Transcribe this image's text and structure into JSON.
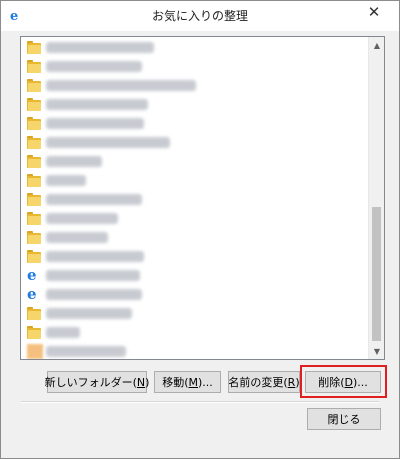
{
  "window": {
    "title": "お気に入りの整理",
    "close_glyph": "✕"
  },
  "list": {
    "items": [
      {
        "icon": "folder-icon"
      },
      {
        "icon": "folder-icon"
      },
      {
        "icon": "folder-icon"
      },
      {
        "icon": "folder-icon"
      },
      {
        "icon": "folder-icon"
      },
      {
        "icon": "folder-icon"
      },
      {
        "icon": "folder-icon"
      },
      {
        "icon": "folder-icon"
      },
      {
        "icon": "folder-icon"
      },
      {
        "icon": "folder-icon"
      },
      {
        "icon": "folder-icon"
      },
      {
        "icon": "folder-icon"
      },
      {
        "icon": "ie-icon"
      },
      {
        "icon": "ie-icon"
      },
      {
        "icon": "folder-icon"
      },
      {
        "icon": "folder-icon"
      },
      {
        "icon": "orange-icon"
      },
      {
        "icon": "fmv-logo-icon",
        "label": "FMVサポート 富士通",
        "selected": true
      }
    ]
  },
  "buttons": {
    "new_folder": {
      "text": "新しいフォルダー(",
      "key": "N",
      "suffix": ")"
    },
    "move": {
      "text": "移動(",
      "key": "M",
      "suffix": ")..."
    },
    "rename": {
      "text": "名前の変更(",
      "key": "R",
      "suffix": ")"
    },
    "delete": {
      "text": "削除(",
      "key": "D",
      "suffix": ")..."
    },
    "close": {
      "text": "閉じる"
    }
  },
  "colors": {
    "selection": "#3399ff",
    "highlight_box": "#e02020",
    "folder": "#e8b830"
  }
}
